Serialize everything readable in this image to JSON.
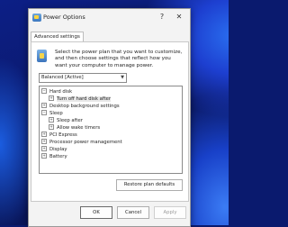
{
  "window": {
    "title": "Power Options",
    "help_glyph": "?",
    "close_glyph": "✕"
  },
  "tabs": [
    {
      "label": "Advanced settings"
    }
  ],
  "description": "Select the power plan that you want to customize, and then choose settings that reflect how you want your computer to manage power.",
  "plan_select": {
    "value": "Balanced [Active]"
  },
  "tree": [
    {
      "label": "Hard disk",
      "expander": "−"
    },
    {
      "label": "Turn off hard disk after",
      "expander": "+"
    },
    {
      "label": "Desktop background settings",
      "expander": "+"
    },
    {
      "label": "Sleep",
      "expander": "−"
    },
    {
      "label": "Sleep after",
      "expander": "+"
    },
    {
      "label": "Allow wake timers",
      "expander": "+"
    },
    {
      "label": "PCI Express",
      "expander": "+"
    },
    {
      "label": "Processor power management",
      "expander": "+"
    },
    {
      "label": "Display",
      "expander": "+"
    },
    {
      "label": "Battery",
      "expander": "+"
    }
  ],
  "buttons": {
    "restore": "Restore plan defaults",
    "ok": "OK",
    "cancel": "Cancel",
    "apply": "Apply"
  },
  "icons": {
    "app": "power-options-icon",
    "panel": "power-plan-icon",
    "dropdown": "chevron-down-icon"
  }
}
